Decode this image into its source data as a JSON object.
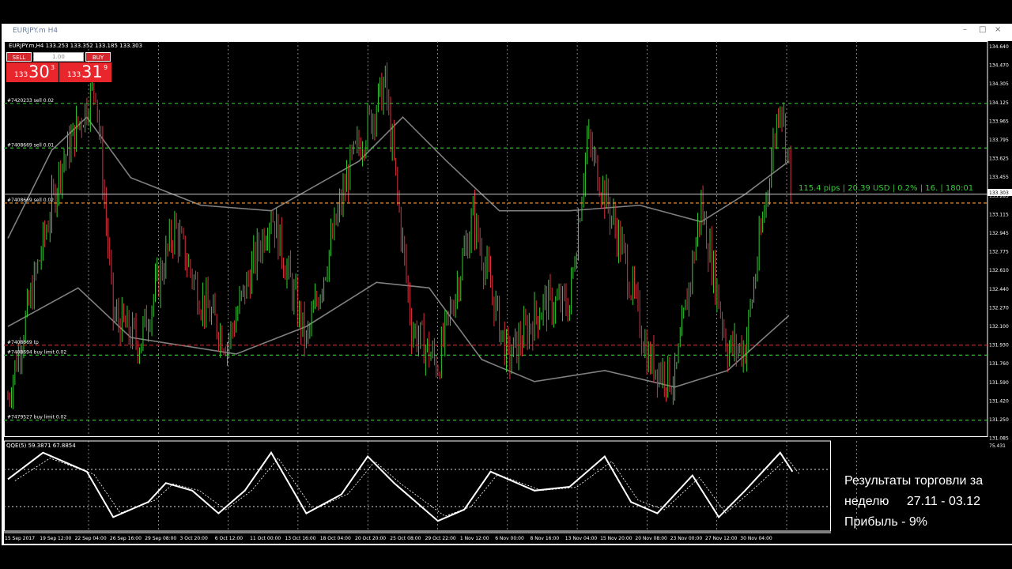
{
  "window": {
    "title": "EURJPY.m H4",
    "minimize": "–",
    "maximize": "□",
    "close": "×"
  },
  "chart": {
    "header": "EURJPY.m,H4  133.253 133.352 133.185 133.303",
    "price_axis": [
      "134.640",
      "134.470",
      "134.305",
      "134.125",
      "133.965",
      "133.795",
      "133.625",
      "133.455",
      "133.285",
      "133.115",
      "132.945",
      "132.775",
      "132.610",
      "132.440",
      "132.270",
      "132.100",
      "131.930",
      "131.760",
      "131.590",
      "131.420",
      "131.250",
      "131.085"
    ],
    "current_price": "133.303",
    "time_axis": [
      "15 Sep 2017",
      "19 Sep 12:00",
      "22 Sep 04:00",
      "26 Sep 16:00",
      "29 Sep 08:00",
      "3 Oct 20:00",
      "6 Oct 12:00",
      "11 Oct 00:00",
      "13 Oct 16:00",
      "18 Oct 04:00",
      "20 Oct 20:00",
      "25 Oct 08:00",
      "29 Oct 22:00",
      "1 Nov 12:00",
      "6 Nov 00:00",
      "8 Nov 16:00",
      "13 Nov 04:00",
      "15 Nov 20:00",
      "20 Nov 08:00",
      "23 Nov 00:00",
      "27 Nov 12:00",
      "30 Nov 04:00"
    ],
    "order_labels": [
      "#7420233 sell 0.02",
      "#7408669 sell 0.01",
      "#7408669 sell 0.02",
      "#7408669 tp",
      "#7408694 buy limit 0.02",
      "#7479527 buy limit 0.02"
    ],
    "profit_line": "115.4 pips | 20.39 USD | 0.2% | 16. | 180:01",
    "indicator_header": "QQE(5) 59.3871 67.8854",
    "indicator_axis": "75.431",
    "colors": {
      "bull": "#33cc33",
      "bear": "#e03040",
      "level": "#33bb33",
      "stop": "#dd2222",
      "ma": "#808080"
    }
  },
  "trade_panel": {
    "sell_label": "SELL",
    "buy_label": "BUY",
    "lot_value": "1.00",
    "sell_price_small": "133",
    "sell_price_big": "30",
    "sell_price_sup": "3",
    "buy_price_small": "133",
    "buy_price_big": "31",
    "buy_price_sup": "9"
  },
  "results": {
    "line1": "Результаты торговли за",
    "line2_word": "неделю",
    "line2_dates": "27.11 - 03.12",
    "line3": "Прибыль -   9%"
  }
}
